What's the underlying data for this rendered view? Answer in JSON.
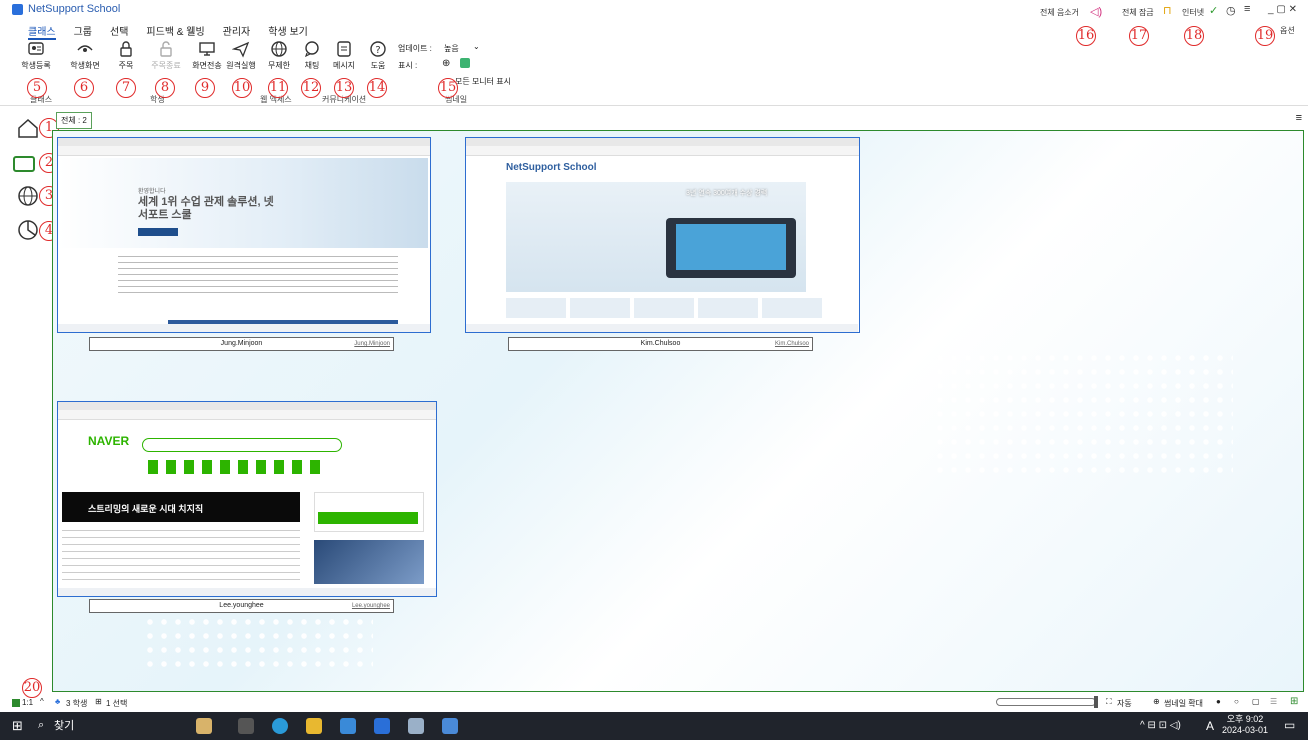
{
  "app": {
    "title": "NetSupport School"
  },
  "menu": [
    "클래스",
    "그룹",
    "선택",
    "피드백 & 웰빙",
    "관리자",
    "학생 보기"
  ],
  "ribbon": {
    "buttons": [
      {
        "label": "학생등록",
        "icon": "register-icon",
        "marker": "5"
      },
      {
        "label": "학생화면",
        "icon": "eye-icon",
        "marker": "6"
      },
      {
        "label": "주목",
        "icon": "lock-icon",
        "marker": "7"
      },
      {
        "label": "주목종료",
        "icon": "unlock-icon",
        "marker": "8",
        "disabled": true
      },
      {
        "label": "화면전송",
        "icon": "monitor-icon",
        "marker": "9"
      },
      {
        "label": "원격실행",
        "icon": "send-icon",
        "marker": "10"
      },
      {
        "label": "무제한",
        "icon": "globe-icon",
        "marker": "11"
      },
      {
        "label": "채팅",
        "icon": "chat-icon",
        "marker": "12"
      },
      {
        "label": "메시지",
        "icon": "message-icon",
        "marker": "13"
      },
      {
        "label": "도움",
        "icon": "help-icon",
        "marker": "14"
      }
    ],
    "groups": [
      "클래스",
      "학생",
      "웹 액세스",
      "커뮤니케이션",
      "썸네일"
    ],
    "update_label": "업데이트 :",
    "update_value": "높음",
    "display_label": "표시 :",
    "monitor_label": "모든 모니터 표시"
  },
  "topright": {
    "mute_all": "전체 음소거",
    "lock_all": "전체 잠금",
    "internet": "인터넷",
    "options": "옵션"
  },
  "markers": {
    "m1": "1",
    "m2": "2",
    "m3": "3",
    "m4": "4",
    "m15": "15",
    "m16": "16",
    "m17": "17",
    "m18": "18",
    "m19": "19",
    "m20": "20"
  },
  "tab": {
    "label": "전체 : 2"
  },
  "students": [
    {
      "name": "Jung.Minjoon",
      "sub": "Jung.Minjoon",
      "page_heading": "세계 1위 수업 관제 솔루션, 넷서포트 스쿨",
      "greeting": "환영합니다"
    },
    {
      "name": "Kim.Chulsoo",
      "sub": "Kim.Chulsoo",
      "page_heading": "NetSupport School",
      "greeting": "3년 연속 300여개 수상 경력"
    },
    {
      "name": "Lee.younghee",
      "sub": "Lee.younghee",
      "page_heading": "NAVER",
      "greeting": "스트리밍의 새로운 시대 치지직"
    }
  ],
  "status": {
    "left1": "1:1",
    "students": "3 학생",
    "selected": "1 선택",
    "auto": "자동",
    "zoom": "썸네일 확대"
  },
  "taskbar": {
    "search": "찾기",
    "time": "오후 9:02",
    "date": "2024-03-01",
    "lang": "A"
  },
  "colors": {
    "accent": "#1a56b8",
    "frame": "#2d8a2d",
    "marker": "#e02a2a",
    "taskbar": "#20242c"
  }
}
